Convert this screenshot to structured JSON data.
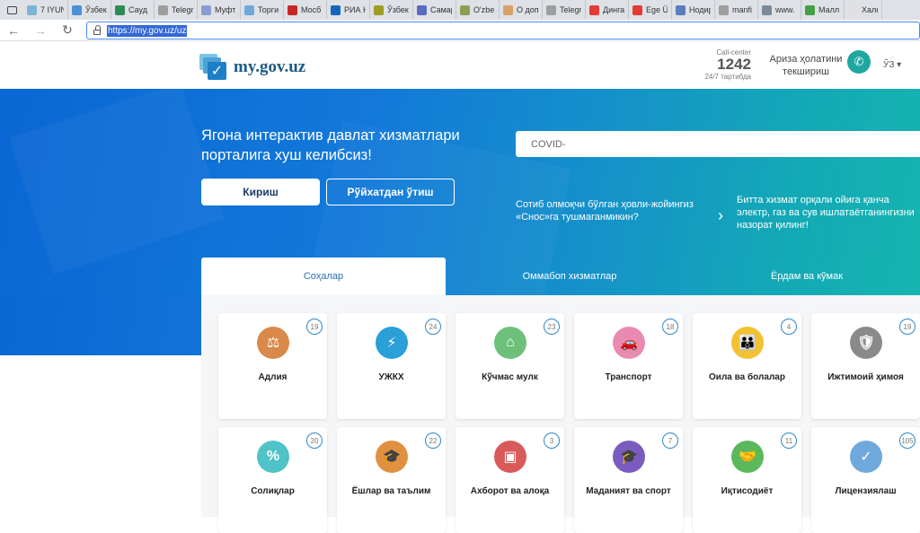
{
  "browser": {
    "tabs": [
      {
        "label": "7 IYUN",
        "color": "#7fb3d5"
      },
      {
        "label": "Ўзбек",
        "color": "#4a90d9"
      },
      {
        "label": "Сауд",
        "color": "#2e8b57"
      },
      {
        "label": "Telegr",
        "color": "#9e9e9e"
      },
      {
        "label": "Муфт",
        "color": "#8a9bd1"
      },
      {
        "label": "Торги",
        "color": "#6fa8dc"
      },
      {
        "label": "Мосб",
        "color": "#c62828"
      },
      {
        "label": "РИА Н",
        "color": "#1565c0"
      },
      {
        "label": "Ўзбек",
        "color": "#9e9d24"
      },
      {
        "label": "Самар",
        "color": "#5c6bc0"
      },
      {
        "label": "O'zbe",
        "color": "#8d9e58"
      },
      {
        "label": "О доп",
        "color": "#d9a066"
      },
      {
        "label": "Telegr",
        "color": "#9e9e9e"
      },
      {
        "label": "Динга",
        "color": "#e53935"
      },
      {
        "label": "Ege Ü",
        "color": "#e53935"
      },
      {
        "label": "Нодир",
        "color": "#5c7cbf"
      },
      {
        "label": "manfi",
        "color": "#9e9e9e"
      },
      {
        "label": "www.",
        "color": "#7a8a9a"
      },
      {
        "label": "Малл",
        "color": "#43a047"
      },
      {
        "label": "Халқ",
        "color": "#e0e0e0"
      }
    ],
    "url": "https://my.gov.uz/uz"
  },
  "header": {
    "logo_text": "my.gov.uz",
    "callcenter_label": "Call-center",
    "callcenter_number": "1242",
    "callcenter_hours": "24/7 тартибда",
    "status_check": "Ариза ҳолатини текшириш",
    "language": "ЎЗ ▾"
  },
  "hero": {
    "title": "Ягона интерактив давлат хизматлари порталига хуш келибсиз!",
    "login_label": "Кириш",
    "register_label": "Рўйхатдан ўтиш",
    "search_value": "COVID-",
    "promo1": "Сотиб олмоқчи бўлган ҳовли-жойингиз «Снос»га тушмаганмикин?",
    "promo2": "Битта хизмат орқали ойига қанча электр, газ ва сув ишлатаётганингизни назорат қилинг!"
  },
  "tabs": [
    {
      "label": "Соҳалар",
      "active": true
    },
    {
      "label": "Оммабоп хизматлар",
      "active": false
    },
    {
      "label": "Ёрдам ва кўмак",
      "active": false
    }
  ],
  "categories": [
    {
      "label": "Адлия",
      "count": "19",
      "icon": "scales-icon",
      "glyph": "⚖",
      "color": "#d9894a"
    },
    {
      "label": "УЖКХ",
      "count": "24",
      "icon": "utilities-icon",
      "glyph": "⚡",
      "color": "#2a9fd8"
    },
    {
      "label": "Кўчмас мулк",
      "count": "23",
      "icon": "house-icon",
      "glyph": "⌂",
      "color": "#6cc07a"
    },
    {
      "label": "Транспорт",
      "count": "18",
      "icon": "car-icon",
      "glyph": "🚗",
      "color": "#e98ab0"
    },
    {
      "label": "Оила ва болалар",
      "count": "4",
      "icon": "family-icon",
      "glyph": "👪",
      "color": "#f2c230"
    },
    {
      "label": "Ижтимоий ҳимоя",
      "count": "19",
      "icon": "shield-icon",
      "glyph": "🛡",
      "color": "#8a8a8a"
    },
    {
      "label": "Солиқлар",
      "count": "20",
      "icon": "tax-document-icon",
      "glyph": "%",
      "color": "#4fc3c7"
    },
    {
      "label": "Ёшлар ва таълим",
      "count": "22",
      "icon": "graduation-icon",
      "glyph": "🎓",
      "color": "#e09040"
    },
    {
      "label": "Ахборот ва алоқа",
      "count": "3",
      "icon": "device-icon",
      "glyph": "▣",
      "color": "#d85a5a"
    },
    {
      "label": "Маданият ва спорт",
      "count": "7",
      "icon": "culture-icon",
      "glyph": "🎓",
      "color": "#7a5cc0"
    },
    {
      "label": "Иқтисодиёт",
      "count": "11",
      "icon": "handshake-icon",
      "glyph": "🤝",
      "color": "#5cb85c"
    },
    {
      "label": "Лицензиялаш",
      "count": "105",
      "icon": "certificate-icon",
      "glyph": "✓",
      "color": "#6fa8dc"
    }
  ]
}
